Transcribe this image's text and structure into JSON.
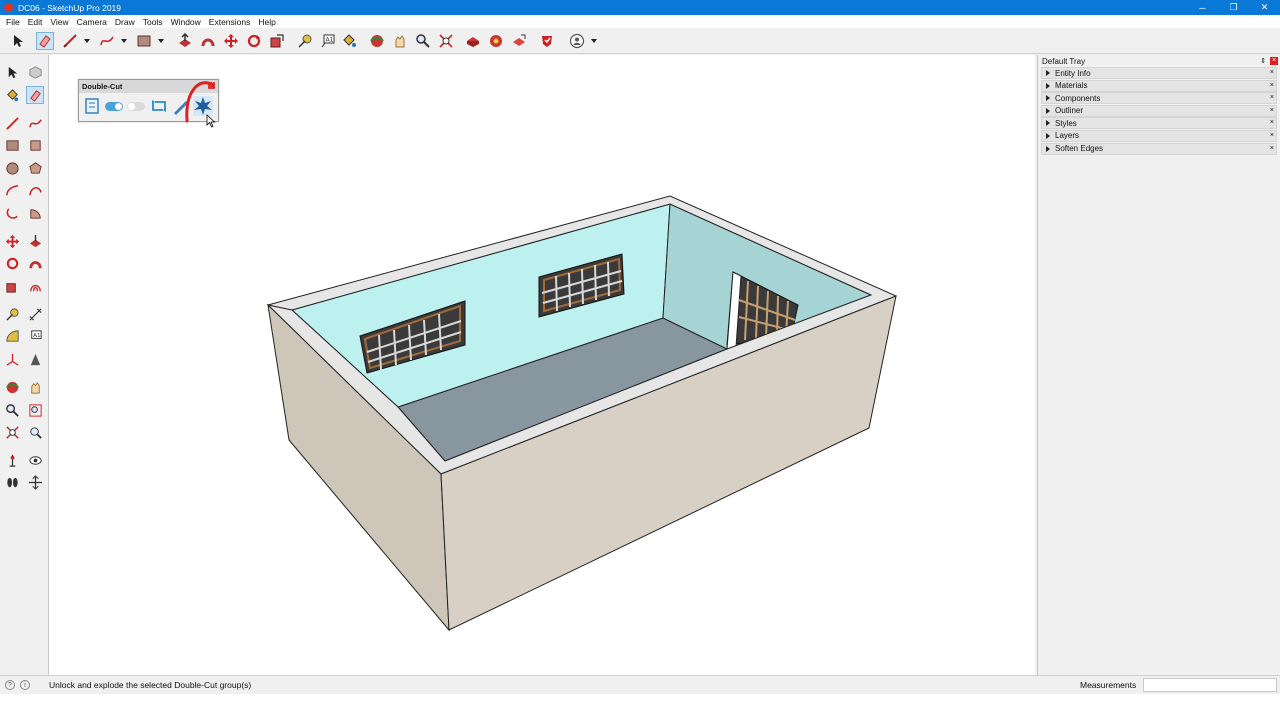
{
  "window": {
    "title": "DC06 - SketchUp Pro 2019",
    "minimize": "─",
    "restore": "❐",
    "close": "✕"
  },
  "menu": [
    "File",
    "Edit",
    "View",
    "Camera",
    "Draw",
    "Tools",
    "Window",
    "Extensions",
    "Help"
  ],
  "double_cut_panel": {
    "title": "Double-Cut",
    "close": "×"
  },
  "tray": {
    "title": "Default Tray",
    "pin": "⇕",
    "close": "×",
    "panels": [
      "Entity Info",
      "Materials",
      "Components",
      "Outliner",
      "Styles",
      "Layers",
      "Soften Edges"
    ]
  },
  "status": {
    "message": "Unlock and explode the selected Double-Cut group(s)",
    "measurements_label": "Measurements",
    "measurements_value": ""
  },
  "colors": {
    "titlebar": "#0a78d7",
    "wall_outer_left": "#cfc6ba",
    "wall_outer_front": "#d8d0c4",
    "wall_top": "#e6e6e6",
    "wall_inner": "#bdf1ef",
    "wall_inner_right": "#a6d4d4",
    "floor": "#8896a0",
    "highlight": "#e02020"
  }
}
